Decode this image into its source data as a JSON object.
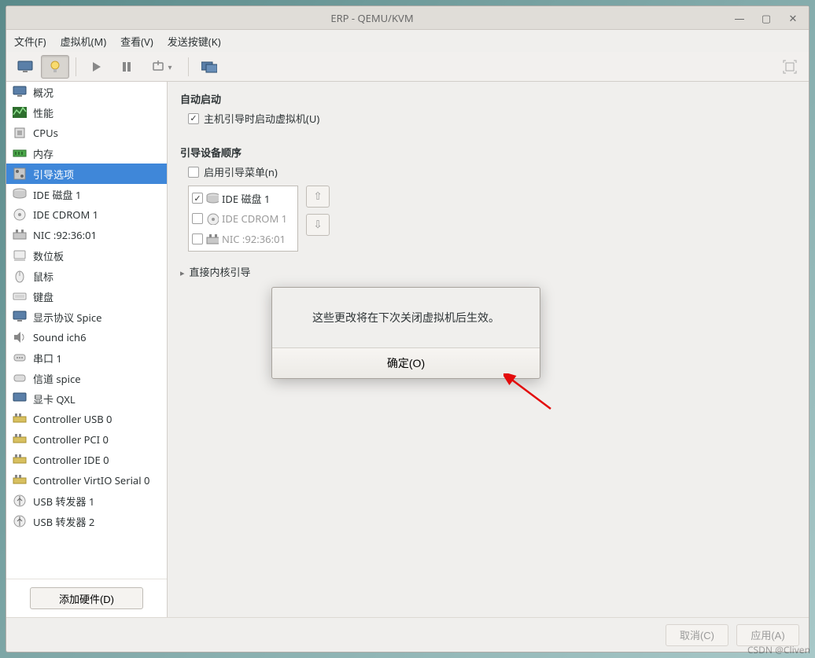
{
  "window": {
    "title": "ERP - QEMU/KVM"
  },
  "menus": {
    "file": "文件(F)",
    "vm": "虚拟机(M)",
    "view": "查看(V)",
    "sendkey": "发送按键(K)"
  },
  "sidebar": {
    "items": [
      {
        "label": "概况"
      },
      {
        "label": "性能"
      },
      {
        "label": "CPUs"
      },
      {
        "label": "内存"
      },
      {
        "label": "引导选项"
      },
      {
        "label": "IDE 磁盘 1"
      },
      {
        "label": "IDE CDROM 1"
      },
      {
        "label": "NIC :92:36:01"
      },
      {
        "label": "数位板"
      },
      {
        "label": "鼠标"
      },
      {
        "label": "键盘"
      },
      {
        "label": "显示协议 Spice"
      },
      {
        "label": "Sound ich6"
      },
      {
        "label": "串口 1"
      },
      {
        "label": "信道 spice"
      },
      {
        "label": "显卡 QXL"
      },
      {
        "label": "Controller USB 0"
      },
      {
        "label": "Controller PCI 0"
      },
      {
        "label": "Controller IDE 0"
      },
      {
        "label": "Controller VirtIO Serial 0"
      },
      {
        "label": "USB 转发器 1"
      },
      {
        "label": "USB 转发器 2"
      }
    ],
    "selected_index": 4,
    "add_hw": "添加硬件(D)"
  },
  "panel": {
    "autostart_title": "自动启动",
    "autostart_chk": "主机引导时启动虚拟机(U)",
    "bootorder_title": "引导设备顺序",
    "bootmenu_chk": "启用引导菜单(n)",
    "boot_devices": [
      {
        "label": "IDE 磁盘 1",
        "checked": true
      },
      {
        "label": "IDE CDROM 1",
        "checked": false
      },
      {
        "label": "NIC :92:36:01",
        "checked": false
      }
    ],
    "kernel_expander": "直接内核引导"
  },
  "footer": {
    "cancel": "取消(C)",
    "apply": "应用(A)"
  },
  "dialog": {
    "message": "这些更改将在下次关闭虚拟机后生效。",
    "ok": "确定(O)"
  },
  "watermark": "CSDN @Cliven"
}
